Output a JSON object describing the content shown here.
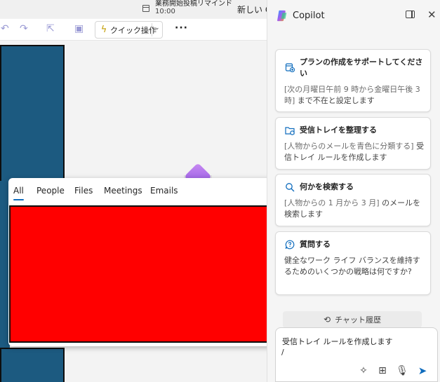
{
  "topbar": {
    "reminder_title": "業務開始投稿リマインド",
    "reminder_time": "10:00",
    "new_tab_label": "新しい C"
  },
  "ribbon": {
    "quick_action_label": "クイック操作",
    "more_label": "···"
  },
  "search_popup": {
    "tabs": [
      "All",
      "People",
      "Files",
      "Meetings",
      "Emails"
    ],
    "active_tab": "All"
  },
  "copilot": {
    "title": "Copilot",
    "cards": [
      {
        "icon": "calendar-plan-icon",
        "title": "プランの作成をサポートしてください",
        "hint": "[次の月曜日午前 9 時から金曜日午後 3 時]",
        "desc": " まで不在と設定します"
      },
      {
        "icon": "inbox-folder-icon",
        "title": "受信トレイを整理する",
        "hint": "[人物からのメールを青色に分類する]",
        "desc": " 受信トレイ ルールを作成します"
      },
      {
        "icon": "search-icon",
        "title": "何かを検索する",
        "hint": "[人物からの 1 月から 3 月]",
        "desc": " のメールを検索します"
      },
      {
        "icon": "question-chat-icon",
        "title": "質問する",
        "hint": "",
        "desc": "健全なワーク ライフ バランスを維持するためのいくつかの戦略は何ですか?"
      }
    ],
    "history_label": "チャット履歴",
    "composer_text": "受信トレイ ルールを作成します",
    "composer_slash": "/"
  },
  "colors": {
    "accent": "#0f6cbd",
    "blue_panel": "#1c5a80",
    "redacted": "#ff0000"
  }
}
